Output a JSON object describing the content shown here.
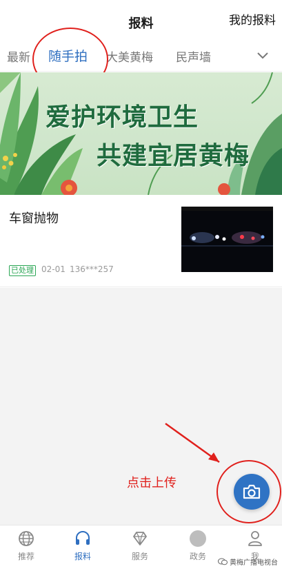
{
  "header": {
    "title": "报料",
    "my_report_label": "我的报料"
  },
  "tabs": [
    {
      "label": "最新",
      "active": false
    },
    {
      "label": "随手拍",
      "active": true
    },
    {
      "label": "大美黄梅",
      "active": false
    },
    {
      "label": "民声墙",
      "active": false
    }
  ],
  "banner": {
    "line1": "爱护环境卫生",
    "line2": "共建宜居黄梅"
  },
  "news": {
    "title": "车窗抛物",
    "status_badge": "已处理",
    "date": "02-01",
    "phone": "136***257"
  },
  "annotation": {
    "text": "点击上传"
  },
  "bottom_nav": [
    {
      "label": "推荐",
      "icon": "globe-icon",
      "active": false
    },
    {
      "label": "报料",
      "icon": "headphones-icon",
      "active": true
    },
    {
      "label": "服务",
      "icon": "diamond-icon",
      "active": false
    },
    {
      "label": "政务",
      "icon": "circle-icon",
      "active": false
    },
    {
      "label": "我",
      "icon": "user-icon",
      "active": false
    }
  ],
  "watermark": "黄梅广播电视台",
  "colors": {
    "accent": "#2f6fc0",
    "fab": "#2f73c4",
    "annotation": "#e0201c",
    "badge": "#2aa654"
  }
}
